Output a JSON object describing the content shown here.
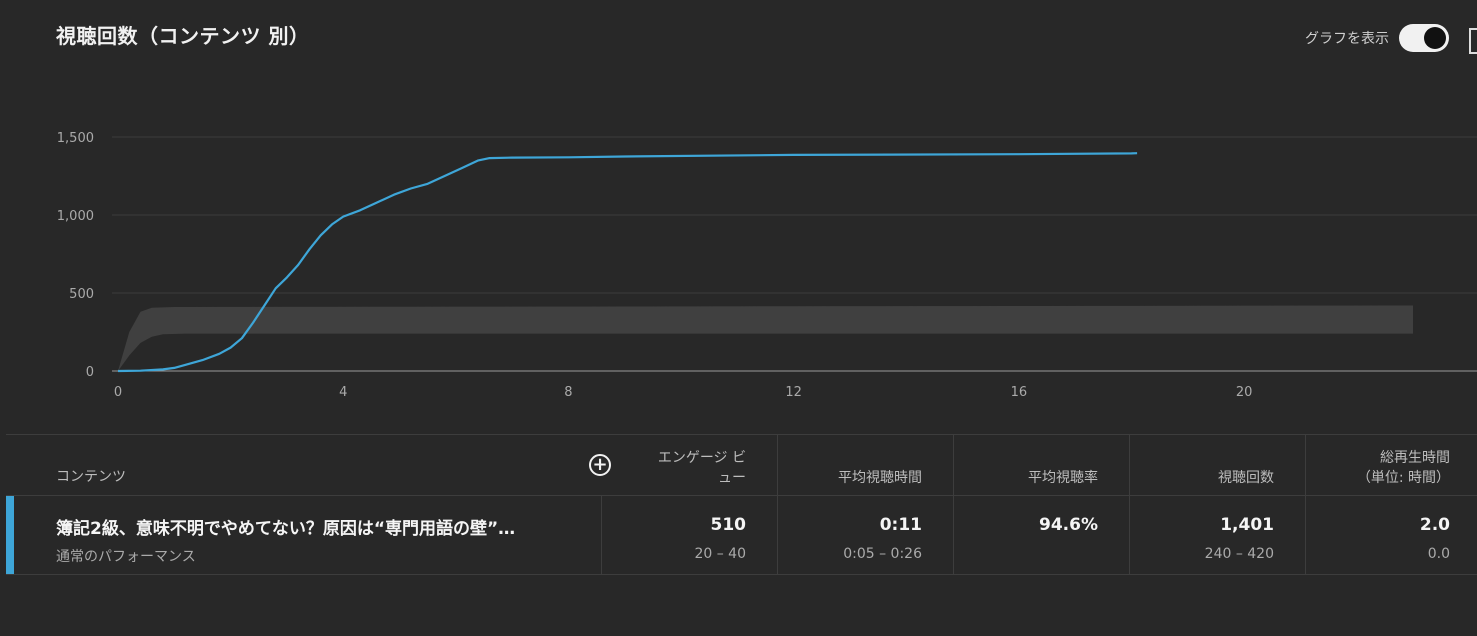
{
  "header": {
    "title": "視聴回数（コンテンツ 別）",
    "toggle_label": "グラフを表示",
    "toggle_on": true
  },
  "chart_data": {
    "type": "line",
    "x_ticks": [
      "0",
      "4",
      "8",
      "12",
      "16",
      "20"
    ],
    "y_ticks": [
      "0",
      "500",
      "1,000",
      "1,500"
    ],
    "xlim": [
      0,
      23
    ],
    "ylim": [
      0,
      1500
    ],
    "grid": true,
    "series": [
      {
        "color": "#3ea6d8",
        "points": [
          [
            0,
            0
          ],
          [
            0.4,
            2
          ],
          [
            0.8,
            10
          ],
          [
            1.0,
            20
          ],
          [
            1.2,
            40
          ],
          [
            1.5,
            70
          ],
          [
            1.8,
            110
          ],
          [
            2.0,
            150
          ],
          [
            2.2,
            210
          ],
          [
            2.4,
            310
          ],
          [
            2.6,
            420
          ],
          [
            2.8,
            530
          ],
          [
            3.0,
            600
          ],
          [
            3.2,
            680
          ],
          [
            3.4,
            780
          ],
          [
            3.6,
            870
          ],
          [
            3.8,
            940
          ],
          [
            4.0,
            990
          ],
          [
            4.3,
            1030
          ],
          [
            4.6,
            1080
          ],
          [
            4.9,
            1130
          ],
          [
            5.2,
            1170
          ],
          [
            5.5,
            1200
          ],
          [
            5.8,
            1250
          ],
          [
            6.1,
            1300
          ],
          [
            6.4,
            1350
          ],
          [
            6.6,
            1365
          ],
          [
            7.0,
            1368
          ],
          [
            8.0,
            1370
          ],
          [
            9.0,
            1375
          ],
          [
            12.0,
            1385
          ],
          [
            16.0,
            1390
          ],
          [
            18.0,
            1395
          ],
          [
            18.1,
            1396
          ]
        ]
      }
    ],
    "performance_band": {
      "color": "#404040",
      "lower": [
        [
          0,
          0
        ],
        [
          0.2,
          100
        ],
        [
          0.4,
          180
        ],
        [
          0.6,
          220
        ],
        [
          0.8,
          235
        ],
        [
          1.2,
          240
        ],
        [
          23,
          240
        ]
      ],
      "upper": [
        [
          0,
          0
        ],
        [
          0.2,
          250
        ],
        [
          0.4,
          380
        ],
        [
          0.6,
          405
        ],
        [
          1.0,
          410
        ],
        [
          23,
          420
        ]
      ]
    }
  },
  "table": {
    "headers": {
      "content": "コンテンツ",
      "engaged_views_line1": "エンゲージ ビ",
      "engaged_views_line2": "ュー",
      "avg_view_duration": "平均視聴時間",
      "avg_percentage": "平均視聴率",
      "views": "視聴回数",
      "watch_time_line1": "総再生時間",
      "watch_time_line2": "（単位: 時間）"
    },
    "row": {
      "title": "簿記2級、意味不明でやめてない？原因は“専門用語の壁”…",
      "subtitle": "通常のパフォーマンス",
      "engaged_views": "510",
      "engaged_views_range": "20 – 40",
      "avg_view_duration": "0:11",
      "avg_view_duration_range": "0:05 – 0:26",
      "avg_percentage": "94.6%",
      "views": "1,401",
      "views_range": "240 – 420",
      "watch_time": "2.0",
      "watch_time_range": "0.0"
    }
  }
}
